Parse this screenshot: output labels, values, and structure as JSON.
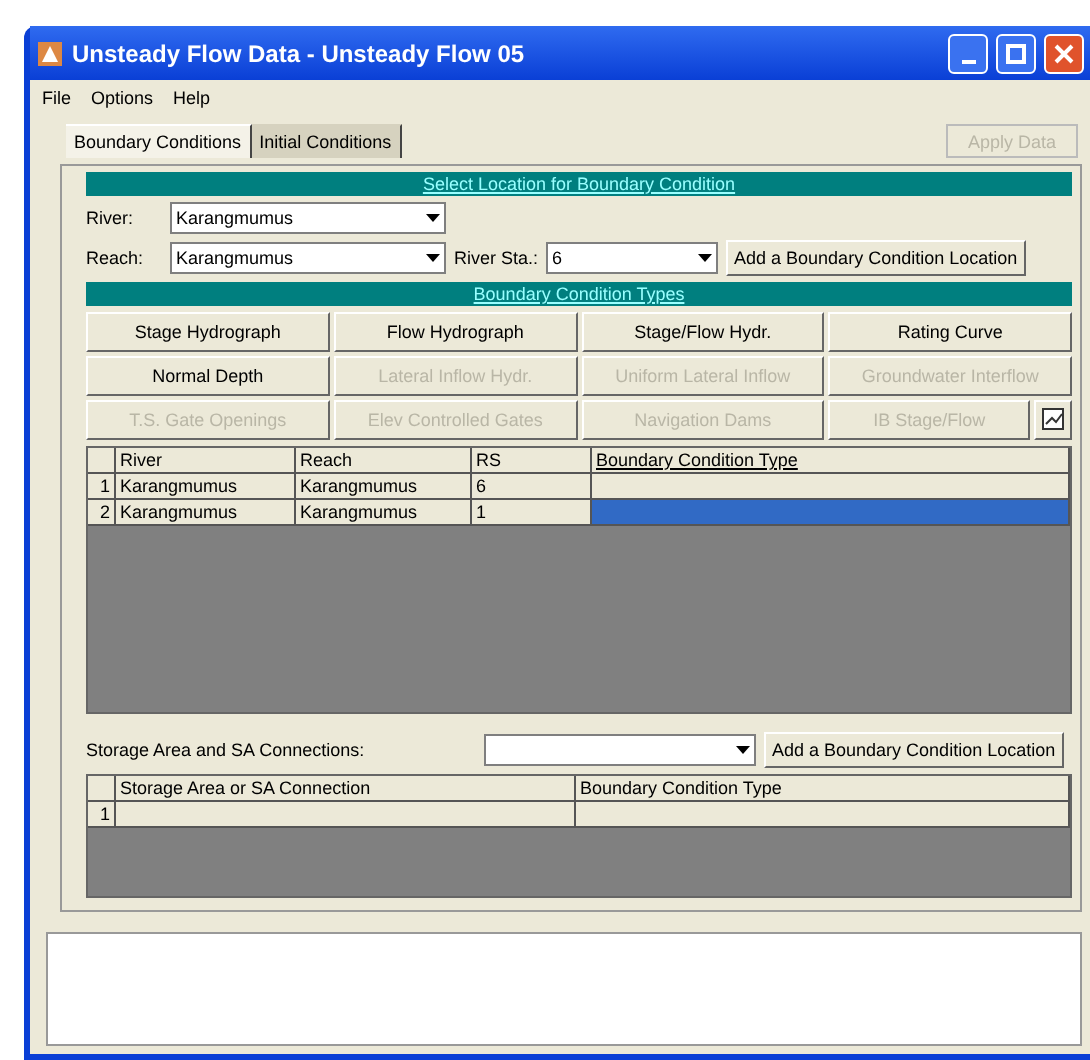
{
  "window": {
    "title": "Unsteady Flow Data - Unsteady Flow 05"
  },
  "menu": [
    "File",
    "Options",
    "Help"
  ],
  "tabs": [
    {
      "label": "Boundary Conditions",
      "selected": true
    },
    {
      "label": "Initial Conditions",
      "selected": false
    }
  ],
  "apply_button": {
    "label": "Apply Data",
    "disabled": true
  },
  "location": {
    "header": "Select Location for Boundary Condition",
    "river_label": "River:",
    "river": "Karangmumus",
    "reach_label": "Reach:",
    "reach": "Karangmumus",
    "station_label": "River Sta.:",
    "station": "6",
    "add_button": "Add a Boundary Condition Location"
  },
  "types": {
    "header": "Boundary Condition Types",
    "buttons": [
      {
        "label": "Stage Hydrograph",
        "disabled": false
      },
      {
        "label": "Flow Hydrograph",
        "disabled": false
      },
      {
        "label": "Stage/Flow Hydr.",
        "disabled": false
      },
      {
        "label": "Rating Curve",
        "disabled": false
      },
      {
        "label": "Normal Depth",
        "disabled": false
      },
      {
        "label": "Lateral Inflow Hydr.",
        "disabled": true
      },
      {
        "label": "Uniform Lateral Inflow",
        "disabled": true
      },
      {
        "label": "Groundwater Interflow",
        "disabled": true
      },
      {
        "label": "T.S. Gate Openings",
        "disabled": true
      },
      {
        "label": "Elev Controlled Gates",
        "disabled": true
      },
      {
        "label": "Navigation Dams",
        "disabled": true
      },
      {
        "label": "IB Stage/Flow",
        "disabled": true
      }
    ]
  },
  "table": {
    "columns": [
      "River",
      "Reach",
      "RS",
      "Boundary Condition Type"
    ],
    "rows": [
      {
        "number": "1",
        "river": "Karangmumus",
        "reach": "Karangmumus",
        "rs": "6",
        "selected": false
      },
      {
        "number": "2",
        "river": "Karangmumus",
        "reach": "Karangmumus",
        "rs": "1",
        "selected": true
      }
    ]
  },
  "storage": {
    "label": "Storage Area and SA Connections:",
    "add_button": "Add a Boundary Condition Location",
    "columns": [
      "Storage Area or SA Connection",
      "Boundary Condition Type"
    ],
    "rows": [
      {
        "number": "1"
      }
    ]
  }
}
